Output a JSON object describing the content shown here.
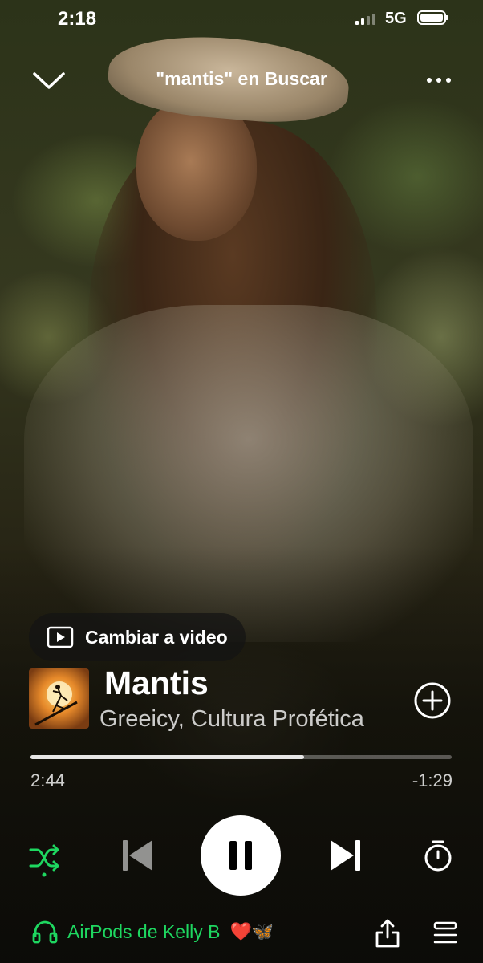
{
  "status_bar": {
    "time": "2:18",
    "network": "5G"
  },
  "header": {
    "title": "\"mantis\" en Buscar"
  },
  "video_switch": {
    "label": "Cambiar a video"
  },
  "track": {
    "title": "Mantis",
    "artists": "Greeicy, Cultura Profética"
  },
  "progress": {
    "elapsed": "2:44",
    "remaining": "-1:29",
    "fraction": 0.65
  },
  "device": {
    "label": "AirPods de Kelly B",
    "emoji": "❤️🦋"
  },
  "colors": {
    "accent_green": "#1ed760",
    "text": "#ffffff"
  },
  "icons": {
    "collapse": "chevron-down-icon",
    "more": "more-dots-icon",
    "video": "video-play-icon",
    "add": "plus-circle-icon",
    "shuffle": "shuffle-icon",
    "previous": "skip-previous-icon",
    "pause": "pause-icon",
    "next": "skip-next-icon",
    "timer": "sleep-timer-icon",
    "headphones": "headphones-icon",
    "share": "share-icon",
    "queue": "queue-icon"
  }
}
